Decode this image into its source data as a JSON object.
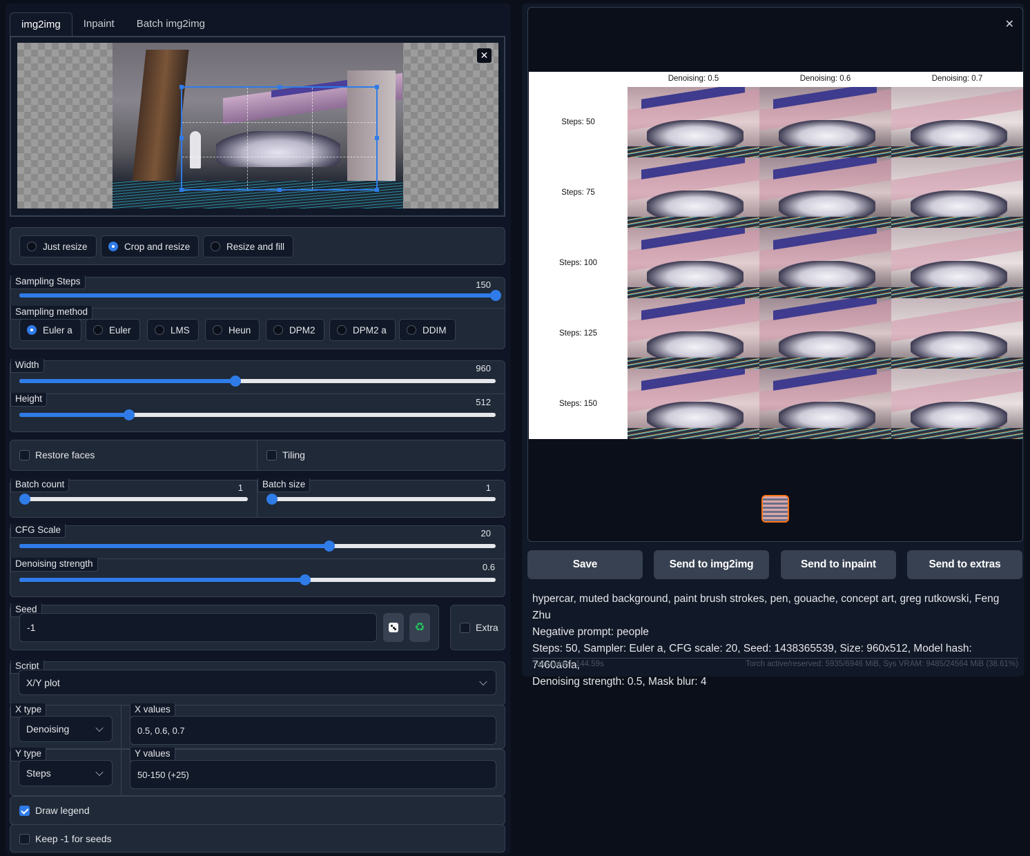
{
  "tabs": [
    "img2img",
    "Inpaint",
    "Batch img2img"
  ],
  "resize_modes": [
    {
      "label": "Just resize",
      "selected": false
    },
    {
      "label": "Crop and resize",
      "selected": true
    },
    {
      "label": "Resize and fill",
      "selected": false
    }
  ],
  "sampling_steps": {
    "label": "Sampling Steps",
    "value": "150",
    "fraction": 1.0
  },
  "sampling_method": {
    "label": "Sampling method",
    "options": [
      "Euler a",
      "Euler",
      "LMS",
      "Heun",
      "DPM2",
      "DPM2 a",
      "DDIM"
    ],
    "selected": "Euler a"
  },
  "width": {
    "label": "Width",
    "value": "960",
    "fraction": 0.454
  },
  "height": {
    "label": "Height",
    "value": "512",
    "fraction": 0.23
  },
  "restore_faces": {
    "label": "Restore faces",
    "checked": false
  },
  "tiling": {
    "label": "Tiling",
    "checked": false
  },
  "batch_count": {
    "label": "Batch count",
    "value": "1",
    "fraction": 0.0
  },
  "batch_size": {
    "label": "Batch size",
    "value": "1",
    "fraction": 0.0
  },
  "cfg_scale": {
    "label": "CFG Scale",
    "value": "20",
    "fraction": 0.65
  },
  "denoising_strength": {
    "label": "Denoising strength",
    "value": "0.6",
    "fraction": 0.6
  },
  "seed": {
    "label": "Seed",
    "value": "-1",
    "dice_icon": "dice-icon",
    "recycle_icon": "recycle-icon"
  },
  "extra": {
    "label": "Extra",
    "checked": false
  },
  "script": {
    "label": "Script",
    "value": "X/Y plot"
  },
  "x_type": {
    "label": "X type",
    "value": "Denoising"
  },
  "x_values": {
    "label": "X values",
    "value": "0.5, 0.6, 0.7"
  },
  "y_type": {
    "label": "Y type",
    "value": "Steps"
  },
  "y_values": {
    "label": "Y values",
    "value": "50-150 (+25)"
  },
  "draw_legend": {
    "label": "Draw legend",
    "checked": true
  },
  "keep_seeds": {
    "label": "Keep -1 for seeds",
    "checked": false
  },
  "grid": {
    "columns": [
      "Denoising: 0.5",
      "Denoising: 0.6",
      "Denoising: 0.7"
    ],
    "rows": [
      "Steps: 50",
      "Steps: 75",
      "Steps: 100",
      "Steps: 125",
      "Steps: 150"
    ]
  },
  "actions": [
    "Save",
    "Send to img2img",
    "Send to inpaint",
    "Send to extras"
  ],
  "info": {
    "prompt": "hypercar, muted background, paint brush strokes, pen, gouache, concept art, greg rutkowski, Feng Zhu",
    "negative": "Negative prompt: people",
    "params_1": "Steps: 50, Sampler: Euler a, CFG scale: 20, Seed: 1438365539, Size: 960x512, Model hash: 7460a6fa,",
    "params_2": "Denoising strength: 0.5, Mask blur: 4"
  },
  "footer": {
    "time": "Time taken: 144.59s",
    "vram": "Torch active/reserved: 5935/6946 MiB, Sys VRAM: 9485/24564 MiB (38.61%)"
  },
  "colors": {
    "accent": "#2f7be8",
    "thumb_border": "#f97316"
  }
}
